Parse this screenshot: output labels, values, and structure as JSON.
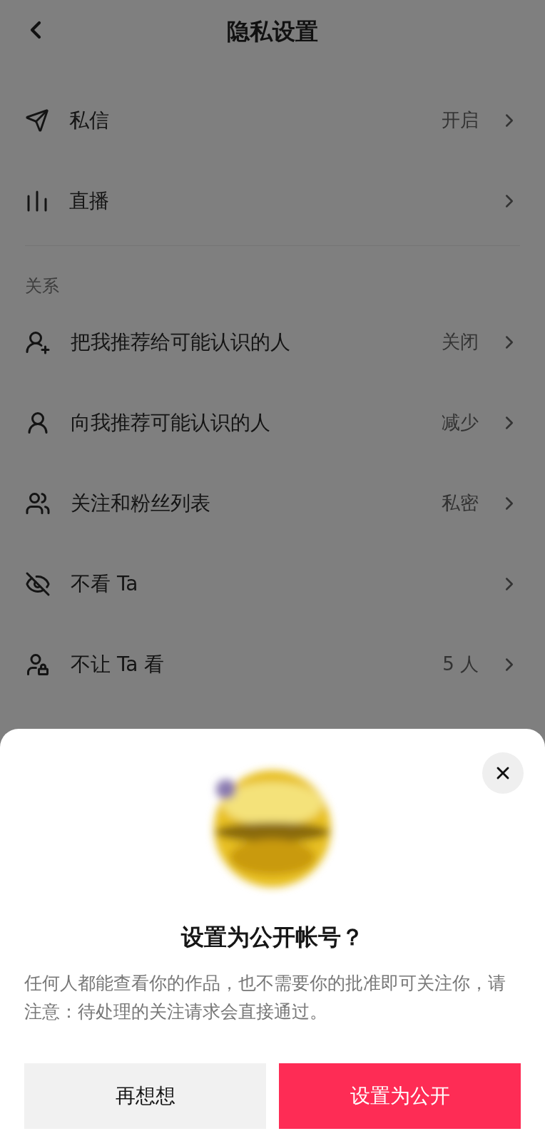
{
  "header": {
    "title": "隐私设置"
  },
  "sections": [
    {
      "items": [
        {
          "label": "私信",
          "value": "开启"
        },
        {
          "label": "直播"
        }
      ]
    },
    {
      "title": "关系",
      "items": [
        {
          "label": "把我推荐给可能认识的人",
          "value": "关闭"
        },
        {
          "label": "向我推荐可能认识的人",
          "value": "减少"
        },
        {
          "label": "关注和粉丝列表",
          "value": "私密"
        },
        {
          "label": "不看 Ta"
        },
        {
          "label": "不让 Ta 看",
          "value": "5 人"
        }
      ]
    }
  ],
  "dialog": {
    "title": "设置为公开帐号？",
    "body": "任何人都能查看你的作品，也不需要你的批准即可关注你，请注意：待处理的关注请求会直接通过。",
    "buttons": [
      {
        "label": "再想想",
        "kind": "secondary"
      },
      {
        "label": "设置为公开",
        "kind": "primary"
      }
    ]
  }
}
